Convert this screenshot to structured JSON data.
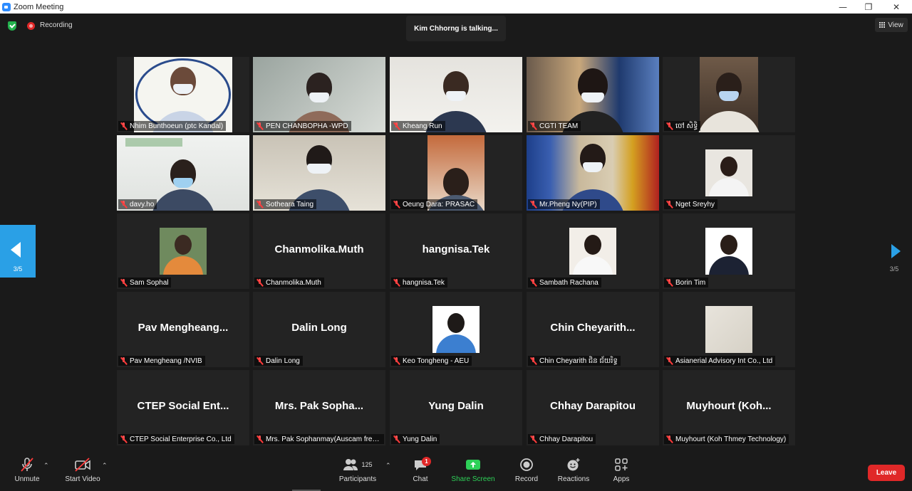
{
  "window": {
    "title": "Zoom Meeting"
  },
  "top": {
    "recording_label": "Recording",
    "talking": "Kim Chhorng is talking...",
    "view_label": "View"
  },
  "nav": {
    "page_left": "3/5",
    "page_right": "3/5"
  },
  "tiles": [
    {
      "name": "Nhim Bunthoeun (ptc Kandal)"
    },
    {
      "name": "PEN CHANBOPHA -WPD"
    },
    {
      "name": "Kheang Run"
    },
    {
      "name": "CGTI TEAM"
    },
    {
      "name": "ចៅ សិទ្ធិ"
    },
    {
      "name": "davy.ho"
    },
    {
      "name": "Sotheara Taing"
    },
    {
      "name": "Oeung Dara: PRASAC"
    },
    {
      "name": "Mr.Pheng Ny(PIP)"
    },
    {
      "name": "Nget Sreyhy"
    },
    {
      "name": "Sam Sophal"
    },
    {
      "name": "Chanmolika.Muth",
      "display": "Chanmolika.Muth"
    },
    {
      "name": "hangnisa.Tek",
      "display": "hangnisa.Tek"
    },
    {
      "name": "Sambath Rachana"
    },
    {
      "name": "Borin Tim"
    },
    {
      "name": "Pav Mengheang /NVIB",
      "display": "Pav Mengheang..."
    },
    {
      "name": "Dalin Long",
      "display": "Dalin Long"
    },
    {
      "name": "Keo Tongheng - AEU"
    },
    {
      "name": "Chin Cheyarith ជិន ជ័យរិទ្ធ",
      "display": "Chin Cheyarith..."
    },
    {
      "name": "Asianerial Advisory Int Co., Ltd"
    },
    {
      "name": "CTEP Social Enterprise Co., Ltd",
      "display": "CTEP Social Ent..."
    },
    {
      "name": "Mrs. Pak Sophanmay(Auscam free...",
      "display": "Mrs. Pak Sopha..."
    },
    {
      "name": "Yung Dalin",
      "display": "Yung Dalin"
    },
    {
      "name": "Chhay Darapitou",
      "display": "Chhay Darapitou"
    },
    {
      "name": "Muyhourt (Koh Thmey Technology)",
      "display": "Muyhourt (Koh..."
    }
  ],
  "toolbar": {
    "unmute": "Unmute",
    "start_video": "Start Video",
    "participants": "Participants",
    "participants_count": "125",
    "chat": "Chat",
    "chat_badge": "1",
    "share_screen": "Share Screen",
    "record": "Record",
    "reactions": "Reactions",
    "apps": "Apps",
    "leave": "Leave"
  }
}
